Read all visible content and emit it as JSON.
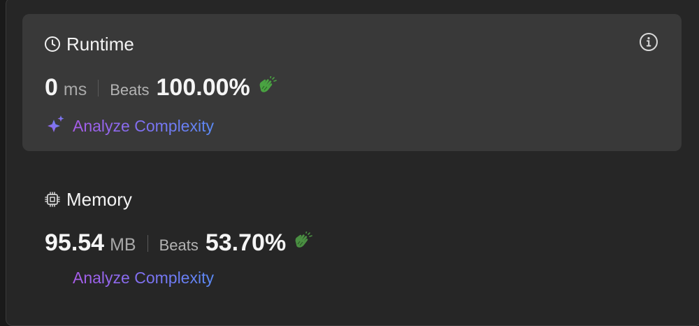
{
  "runtime": {
    "title": "Runtime",
    "value": "0",
    "unit": "ms",
    "beats_label": "Beats",
    "beats_percent": "100.00%",
    "analyze_label": "Analyze Complexity",
    "icon": "clock-icon"
  },
  "memory": {
    "title": "Memory",
    "value": "95.54",
    "unit": "MB",
    "beats_label": "Beats",
    "beats_percent": "53.70%",
    "analyze_label": "Analyze Complexity",
    "icon": "chip-icon"
  },
  "colors": {
    "card_bg": "#393939",
    "panel_bg": "#262626",
    "clap_green": "#4caf50",
    "analyze_gradient_start": "#a85ce8",
    "analyze_gradient_end": "#5b8af5"
  }
}
